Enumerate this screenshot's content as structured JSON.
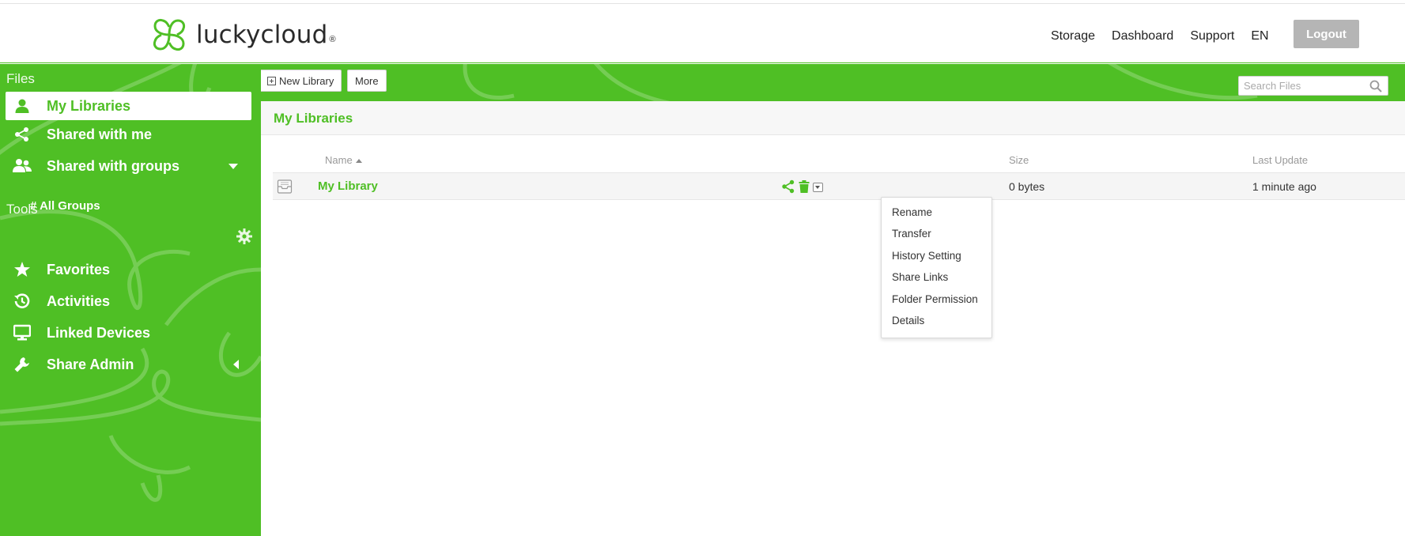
{
  "brand": {
    "name": "luckycloud",
    "reg_mark": "®"
  },
  "topnav": [
    "Storage",
    "Dashboard",
    "Support",
    "EN"
  ],
  "logout_label": "Logout",
  "sidebar": {
    "files_heading": "Files",
    "tools_heading": "Tools",
    "files_items": [
      {
        "label": "My Libraries",
        "icon": "user-icon",
        "active": true
      },
      {
        "label": "Shared with me",
        "icon": "share-icon"
      },
      {
        "label": "Shared with groups",
        "icon": "group-icon"
      }
    ],
    "all_groups": "# All Groups",
    "tools_items": [
      {
        "label": "Favorites",
        "icon": "star-icon"
      },
      {
        "label": "Activities",
        "icon": "history-icon"
      },
      {
        "label": "Linked Devices",
        "icon": "monitor-icon"
      },
      {
        "label": "Share Admin",
        "icon": "wrench-icon"
      }
    ]
  },
  "toolbar": {
    "new_library": "New Library",
    "more": "More",
    "search_placeholder": "Search Files"
  },
  "main": {
    "title": "My Libraries",
    "columns": {
      "name": "Name",
      "size": "Size",
      "last_update": "Last Update"
    },
    "rows": [
      {
        "name": "My Library",
        "size": "0 bytes",
        "last_update": "1 minute ago"
      }
    ]
  },
  "dropdown_menu": [
    "Rename",
    "Transfer",
    "History Setting",
    "Share Links",
    "Folder Permission",
    "Details"
  ],
  "colors": {
    "brand_green": "#4fbf25",
    "logout_gray": "#b5b5b5"
  }
}
